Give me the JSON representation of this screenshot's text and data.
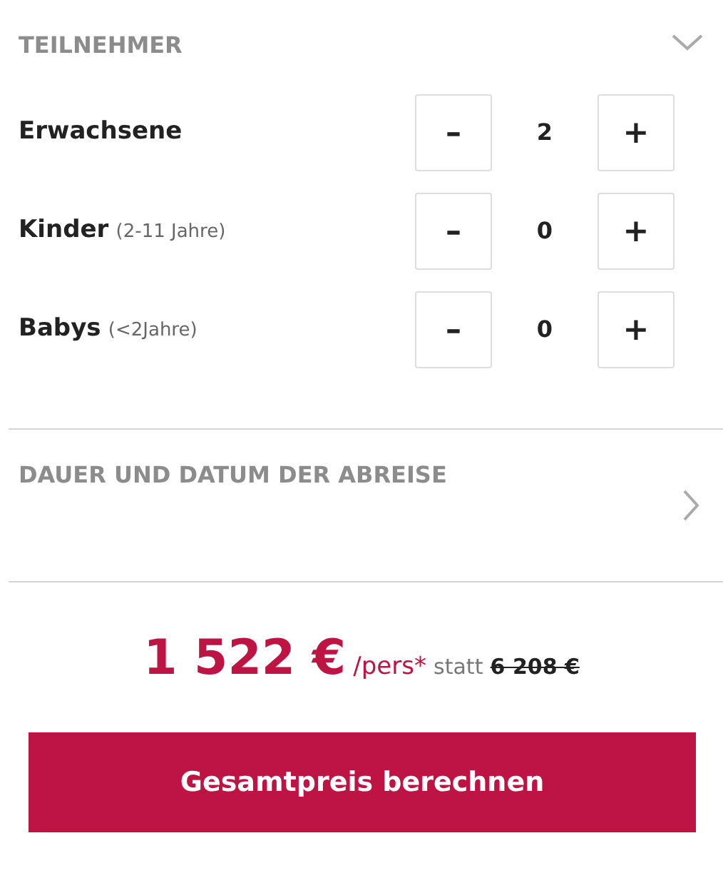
{
  "sections": [
    {
      "title": "TEILNEHMER",
      "expanded": true,
      "rows": [
        {
          "label": "Erwachsene",
          "value": "2",
          "minus": "–",
          "plus": "+"
        },
        {
          "label": "Kinder",
          "note": "(2-11 Jahre)",
          "value": "0",
          "minus": "–",
          "plus": "+"
        },
        {
          "label": "Babys",
          "note": "(<2Jahre)",
          "value": "0",
          "minus": "–",
          "plus": "+"
        }
      ]
    },
    {
      "title": "DAUER UND DATUM DER ABREISE",
      "expanded": false
    }
  ],
  "price": {
    "amount": "1 522 €",
    "unit": "/pers*",
    "instead": "statt",
    "old_price": "6 208 €"
  },
  "button": {
    "label": "Gesamtpreis berechnen"
  }
}
